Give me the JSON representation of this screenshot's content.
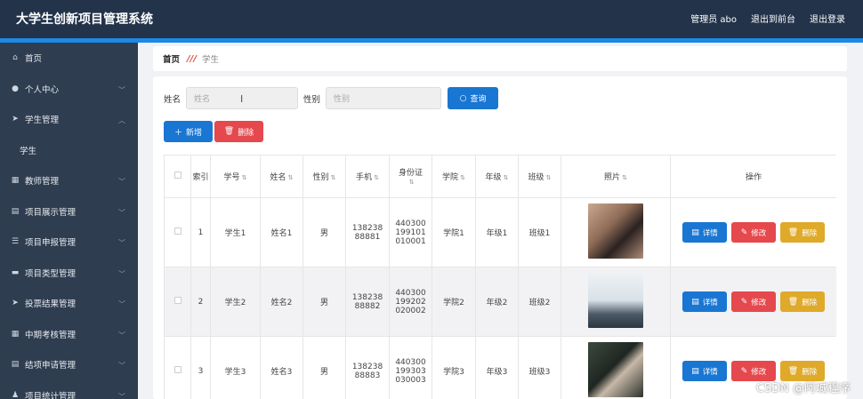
{
  "header": {
    "title": "大学生创新项目管理系统",
    "admin": "管理员 abo",
    "exit_front": "退出到前台",
    "logout": "退出登录"
  },
  "sidebar": {
    "items": [
      {
        "label": "首页",
        "icon": "home-icon"
      },
      {
        "label": "个人中心",
        "icon": "user-icon",
        "has_chevron": true
      },
      {
        "label": "学生管理",
        "icon": "send-icon",
        "expanded": true
      },
      {
        "label": "学生",
        "sub": true
      },
      {
        "label": "教师管理",
        "icon": "grid-icon",
        "has_chevron": true
      },
      {
        "label": "项目展示管理",
        "icon": "clipboard-icon",
        "has_chevron": true
      },
      {
        "label": "项目申报管理",
        "icon": "list-icon",
        "has_chevron": true
      },
      {
        "label": "项目类型管理",
        "icon": "monitor-icon",
        "has_chevron": true
      },
      {
        "label": "投票结果管理",
        "icon": "send-icon",
        "has_chevron": true
      },
      {
        "label": "中期考核管理",
        "icon": "grid-icon",
        "has_chevron": true
      },
      {
        "label": "结项申请管理",
        "icon": "clipboard-icon",
        "has_chevron": true
      },
      {
        "label": "项目统计管理",
        "icon": "person-icon",
        "has_chevron": true
      }
    ]
  },
  "breadcrumb": {
    "home": "首页",
    "current": "学生"
  },
  "search": {
    "name_label": "姓名",
    "name_placeholder": "姓名",
    "gender_label": "性别",
    "gender_placeholder": "性别",
    "query_button": "查询"
  },
  "toolbar": {
    "add_label": "新增",
    "delete_label": "删除"
  },
  "table": {
    "headers": {
      "index": "索引",
      "student_no": "学号",
      "name": "姓名",
      "gender": "性别",
      "phone": "手机",
      "id_card": "身份证",
      "college": "学院",
      "grade": "年级",
      "class": "班级",
      "photo": "照片",
      "ops": "操作"
    },
    "rows": [
      {
        "index": "1",
        "student_no": "学生1",
        "name": "姓名1",
        "gender": "男",
        "phone_1": "138238",
        "phone_2": "88881",
        "id_1": "440300",
        "id_2": "199101",
        "id_3": "010001",
        "college": "学院1",
        "grade": "年级1",
        "class": "班级1"
      },
      {
        "index": "2",
        "student_no": "学生2",
        "name": "姓名2",
        "gender": "男",
        "phone_1": "138238",
        "phone_2": "88882",
        "id_1": "440300",
        "id_2": "199202",
        "id_3": "020002",
        "college": "学院2",
        "grade": "年级2",
        "class": "班级2"
      },
      {
        "index": "3",
        "student_no": "学生3",
        "name": "姓名3",
        "gender": "男",
        "phone_1": "138238",
        "phone_2": "88883",
        "id_1": "440300",
        "id_2": "199303",
        "id_3": "030003",
        "college": "学院3",
        "grade": "年级3",
        "class": "班级3"
      }
    ],
    "row_actions": {
      "detail": "详情",
      "edit": "修改",
      "delete": "删除"
    }
  },
  "watermark": "CSDN @阿城程序",
  "colors": {
    "topbar": "#22334a",
    "accent": "#1e88e5",
    "sidebar": "#2f3d50",
    "primary": "#1976d2",
    "danger": "#e5484d",
    "warning": "#dfa92a"
  }
}
